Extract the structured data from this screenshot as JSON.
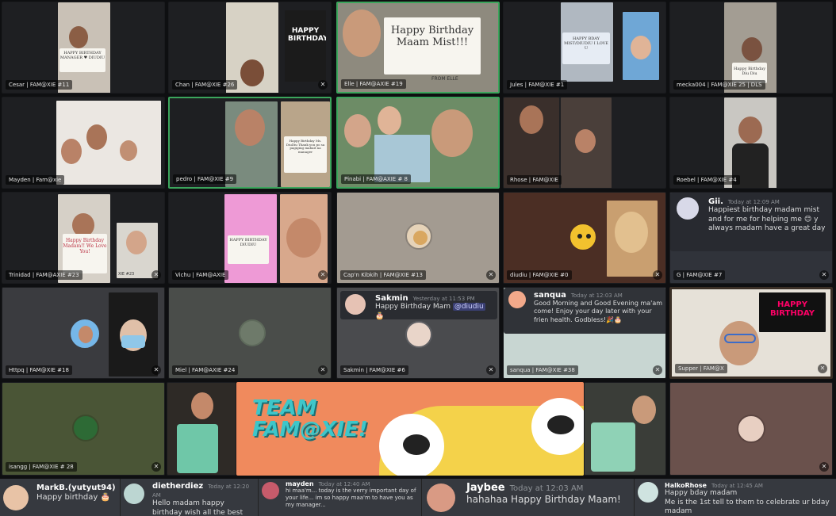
{
  "tiles": [
    {
      "label": "Cesar | FAM@XIE #11",
      "sign": "HAPPY BIRTHDAY MANAGER ♥ DIUDIU"
    },
    {
      "label": "Chan | FAM@XIE #26",
      "sign": "HAPPY BIRTHDAY"
    },
    {
      "label": "Elle | FAM@AXIE #19",
      "sign": "Happy Birthday Maam Mist!!!",
      "sign2": "FROM ELLE"
    },
    {
      "label": "Jules | FAM@XIE #1",
      "sign": "HAPPY BDAY MIST/DIUDIU I LOVE U"
    },
    {
      "label": "mecka004 | FAM@XIE 25 | DLS",
      "sign": "Happy Birthday Diu Diu"
    },
    {
      "label": "Mayden | Fam@xie"
    },
    {
      "label": "pedro | FAM@XIE #9",
      "sign": "Happy Birthday Ms. DiuDiu Thank you po sa pagiging mabait na manager"
    },
    {
      "label": "Pinabi | FAM@AXIE # 8"
    },
    {
      "label": "Rhose | FAM@XIE"
    },
    {
      "label": "Roebel | FAM@XIE #4"
    },
    {
      "label": "Trinidad | FAM@AXIE #23",
      "sign": "Happy Birthday Madam!! We Love You!",
      "sub": "XIE #23"
    },
    {
      "label": "Vichu | FAM@AXIE",
      "sign": "HAPPY BIRTHDAY DIUDIU"
    },
    {
      "label": "Cap'n Kibkih | FAM@XIE #13"
    },
    {
      "label": "diudiu | FAM@XIE #0"
    },
    {
      "label": "G | FAM@XIE #7"
    },
    {
      "label": "Httpq | FAM@XIE #18"
    },
    {
      "label": "Miel | FAM@AXIE #24"
    },
    {
      "label": "Sakmin | FAM@XIE #6"
    },
    {
      "label": "sanqua | FAM@XIE #38"
    },
    {
      "label": "Supper | FAM@X"
    },
    {
      "label": "isangg | FAM@XIE # 28"
    },
    {
      "label": ""
    },
    {
      "label": ""
    }
  ],
  "messages": {
    "gii": {
      "name": "Gii.",
      "time": "Today at 12:09 AM",
      "text": "Happiest birthday madam mist and for me for helping me 😊 y always madam have a great day"
    },
    "sakmin": {
      "name": "Sakmin",
      "time": "Yesterday at 11:53 PM",
      "text": "Happy Birthday Mam",
      "mention": "@diudiu",
      "emoji": "🎂"
    },
    "sanqua": {
      "name": "sanqua",
      "time": "Today at 12:03 AM",
      "text": "Good Morning and Good Evening ma'am come! Enjoy your day later with your frien health. Godbless!🎉🎂"
    }
  },
  "banner": {
    "line1": "TEAM",
    "line2": "FAM@XIE!"
  },
  "happy_birthday_tile": "HAPPY BIRTHDAY",
  "chat_strip": [
    {
      "name": "MarkB.(yutyut94)",
      "time": "",
      "text": "Happy birthday 🎂"
    },
    {
      "name": "dietherdiez",
      "time": "Today at 12:20 AM",
      "text": "Hello madam happy birthday wish all the best maay"
    },
    {
      "name": "mayden",
      "time": "Today at 12:40 AM",
      "text": "hi maa'm... today is the verry important day of your life... im so happy maa'm to have you as my manager..."
    },
    {
      "name": "Jaybee",
      "time": "Today at 12:03 AM",
      "text": "hahahaa Happy Birthday Maam!"
    },
    {
      "name": "HalkoRhose",
      "time": "Today at 12:45 AM",
      "text": "Happy bday madam",
      "text2": "Me is the 1st tell to them to celebrate ur bday madam"
    }
  ],
  "colors": {
    "speaking": "#3ba55c",
    "tile_bg": "#2b2d31",
    "banner_orange": "#f08a5d",
    "banner_teal": "#3ec6c9"
  },
  "icons": {
    "mic_muted": "🎙",
    "chevron_right": "›"
  }
}
